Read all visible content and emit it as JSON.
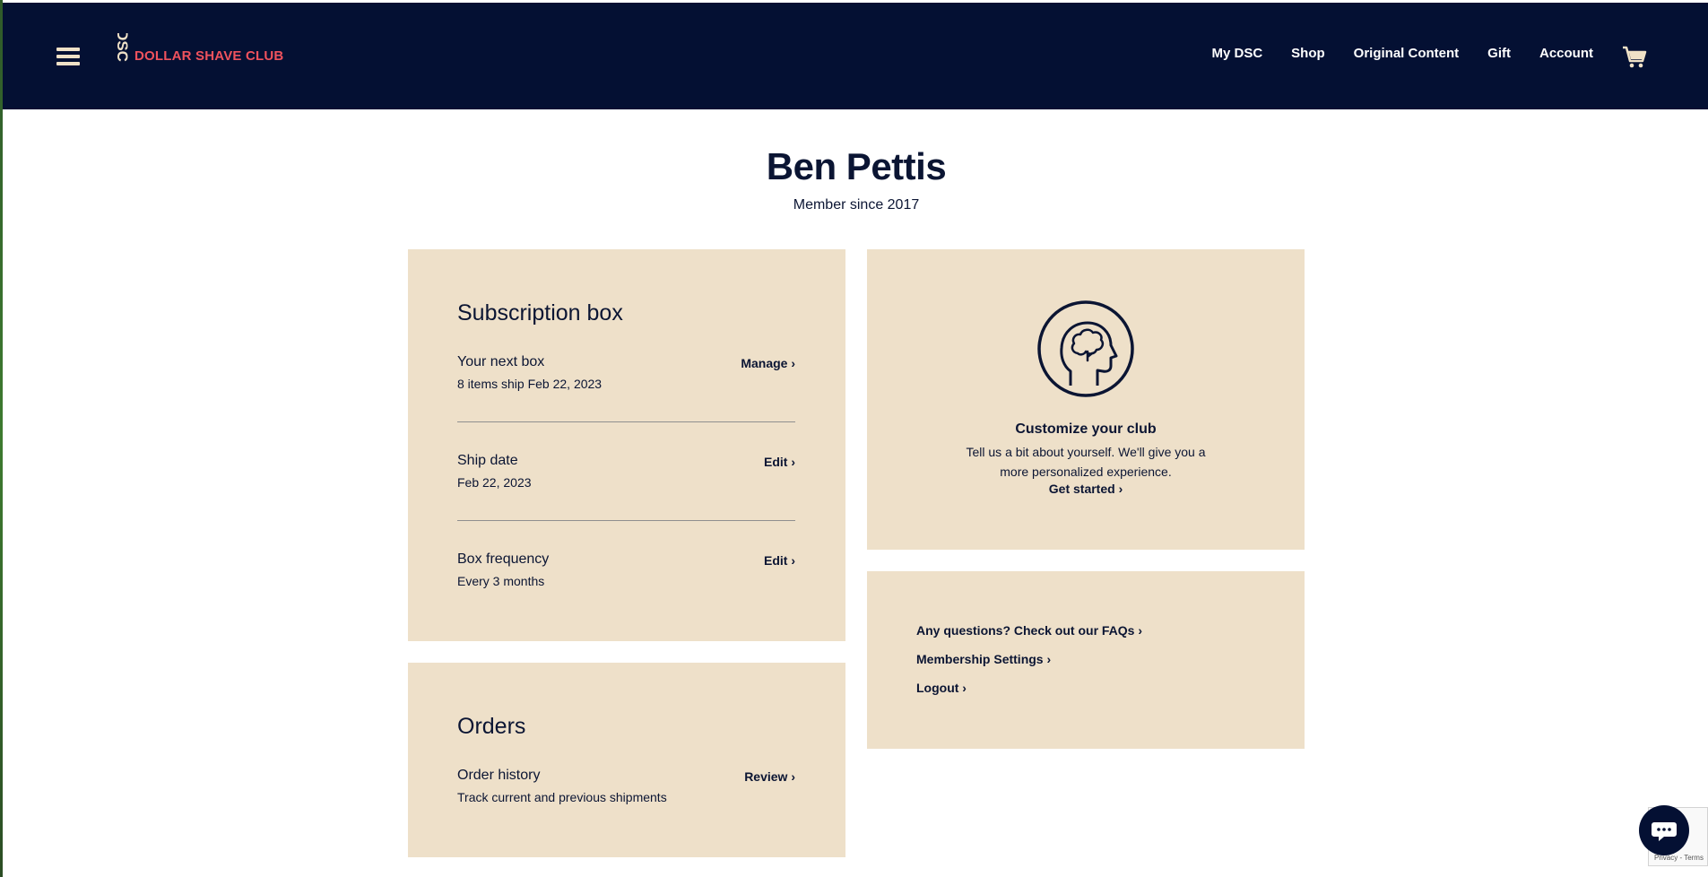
{
  "nav": {
    "logo_mark": "DSC",
    "logo_text": "DOLLAR SHAVE CLUB",
    "links": [
      "My DSC",
      "Shop",
      "Original Content",
      "Gift",
      "Account"
    ]
  },
  "profile": {
    "name": "Ben Pettis",
    "member_since": "Member since 2017"
  },
  "subscription": {
    "title": "Subscription box",
    "rows": [
      {
        "title": "Your next box",
        "sub": "8 items ship Feb 22, 2023",
        "action": "Manage ›"
      },
      {
        "title": "Ship date",
        "sub": "Feb 22, 2023",
        "action": "Edit ›"
      },
      {
        "title": "Box frequency",
        "sub": "Every 3 months",
        "action": "Edit ›"
      }
    ]
  },
  "orders": {
    "title": "Orders",
    "row": {
      "title": "Order history",
      "sub": "Track current and previous shipments",
      "action": "Review ›"
    }
  },
  "customize": {
    "title": "Customize your club",
    "body": "Tell us a bit about yourself. We'll give you a more personalized experience.",
    "cta": "Get started ›"
  },
  "links": [
    "Any questions? Check out our FAQs ›",
    "Membership Settings ›",
    "Logout ›"
  ],
  "recaptcha": {
    "text": "Privacy - Terms"
  },
  "colors": {
    "navbar": "#041033",
    "brand_red": "#f0525d",
    "card_bg": "#eee0c9",
    "ink": "#0b1533"
  }
}
